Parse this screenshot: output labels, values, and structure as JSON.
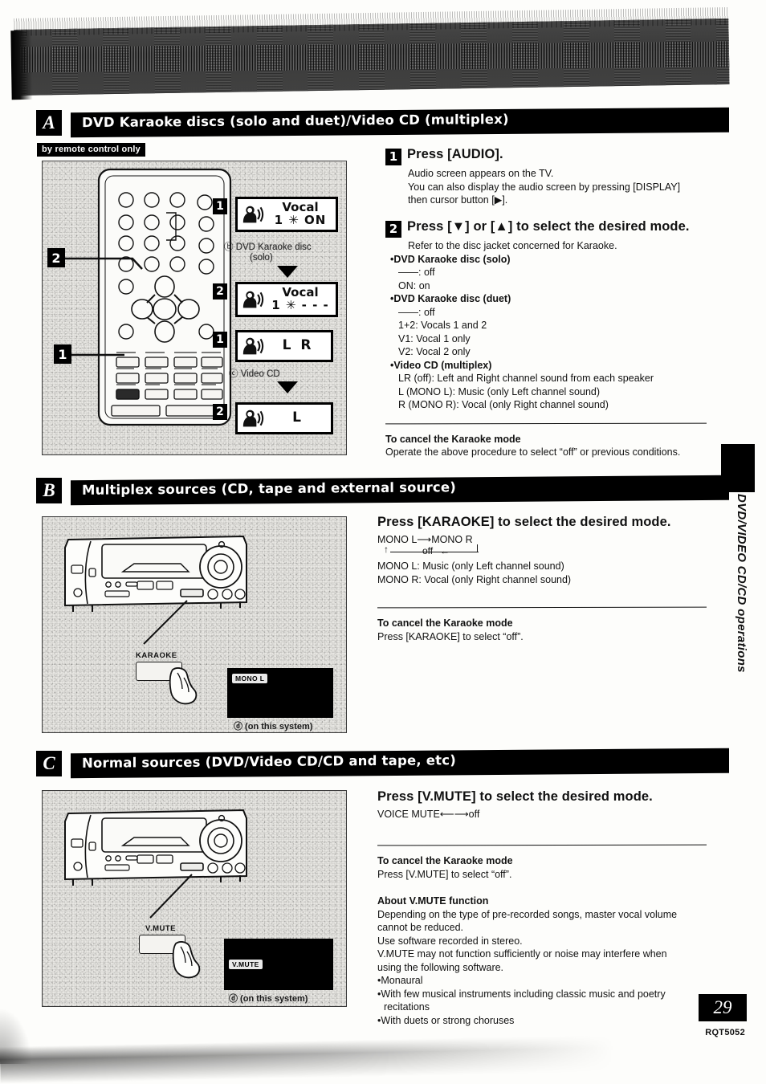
{
  "page": {
    "number": "29",
    "part_number": "RQT5052",
    "side_tab_label": "DVD/VIDEO CD/CD operations"
  },
  "section_a": {
    "letter": "A",
    "title": "DVD Karaoke discs (solo and duet)/Video CD (multiplex)",
    "badge": "by remote control only",
    "remote_callouts": [
      "2",
      "1"
    ],
    "displays": [
      {
        "num": "1",
        "icon": "singer-icon",
        "line1": "Vocal",
        "line2": "1 ✳ ON"
      },
      {
        "num": "2",
        "icon": "singer-icon",
        "line1": "Vocal",
        "line2": "1 ✳ - - -"
      },
      {
        "num": "1",
        "icon": "singer-icon",
        "single": "L R"
      },
      {
        "num": "2",
        "icon": "singer-icon",
        "single": "L"
      }
    ],
    "captions": [
      "ⓑ DVD Karaoke disc",
      "(solo)",
      "ⓒ Video CD"
    ],
    "step1": {
      "num": "1",
      "heading": "Press [AUDIO].",
      "lines": [
        "Audio screen appears on the TV.",
        "You can also display the audio screen by pressing [DISPLAY]",
        "then cursor button [▶]."
      ]
    },
    "step2": {
      "num": "2",
      "heading": "Press [▼] or [▲] to select the desired mode.",
      "intro": "Refer to the disc jacket concerned for Karaoke.",
      "groups": [
        {
          "title": "DVD Karaoke disc (solo)",
          "items": [
            "——: off",
            "ON:  on"
          ]
        },
        {
          "title": "DVD Karaoke disc (duet)",
          "items": [
            "——: off",
            "1+2:  Vocals 1 and 2",
            "V1:  Vocal 1 only",
            "V2:  Vocal 2 only"
          ]
        },
        {
          "title": "Video CD (multiplex)",
          "items": [
            "LR (off):  Left and Right channel sound from each speaker",
            "L (MONO L):  Music (only Left channel sound)",
            "R (MONO R):  Vocal (only Right channel sound)"
          ]
        }
      ]
    },
    "cancel": {
      "heading": "To cancel the Karaoke mode",
      "body": "Operate the above procedure to select “off” or previous conditions."
    }
  },
  "section_b": {
    "letter": "B",
    "title": "Multiplex sources (CD, tape and external source)",
    "illustration": {
      "button_label": "KARAOKE",
      "display_indicator": "MONO  L",
      "caption": "ⓓ (on this system)"
    },
    "heading": "Press [KARAOKE] to select the desired mode.",
    "cycle_top": "MONO L⟶MONO R",
    "cycle_bottom": "off",
    "items": [
      "MONO L:  Music (only Left channel sound)",
      "MONO R:  Vocal (only Right channel sound)"
    ],
    "cancel": {
      "heading": "To cancel the Karaoke mode",
      "body": "Press [KARAOKE] to select “off”."
    }
  },
  "section_c": {
    "letter": "C",
    "title": "Normal sources (DVD/Video CD/CD and tape, etc)",
    "illustration": {
      "button_label": "V.MUTE",
      "display_indicator": "V.MUTE",
      "caption": "ⓓ (on this system)"
    },
    "heading": "Press [V.MUTE] to select the desired mode.",
    "cycle": "VOICE MUTE⟵⟶off",
    "cancel": {
      "heading": "To cancel the Karaoke mode",
      "body": "Press [V.MUTE] to select “off”."
    },
    "about": {
      "heading": "About V.MUTE function",
      "lines": [
        "Depending on the type of pre-recorded songs, master vocal volume",
        "cannot be reduced.",
        "Use software recorded in stereo.",
        "V.MUTE may not function sufficiently or noise may interfere when",
        "using the following software."
      ],
      "bullets": [
        "Monaural",
        "With few musical instruments including classic music and poetry",
        "recitations",
        "With duets or strong choruses"
      ]
    }
  }
}
